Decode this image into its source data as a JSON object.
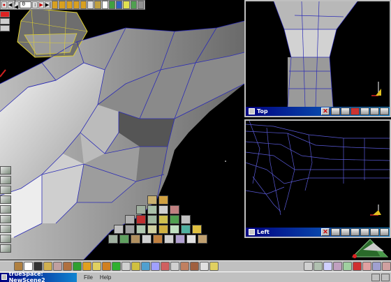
{
  "app": {
    "taskbar_title": "trueSpace: NewScene2",
    "menu": [
      "File",
      "Help"
    ]
  },
  "toolbar": {
    "frame_value": "0"
  },
  "viewports": {
    "top": {
      "name": "Top"
    },
    "left": {
      "name": "Left"
    }
  },
  "colors": {
    "mesh_light": "#e8e8e8",
    "mesh_dark": "#5a5a5a",
    "wire": "#2b2bb5",
    "title_bar": "#000080",
    "close": "#cc0000"
  }
}
